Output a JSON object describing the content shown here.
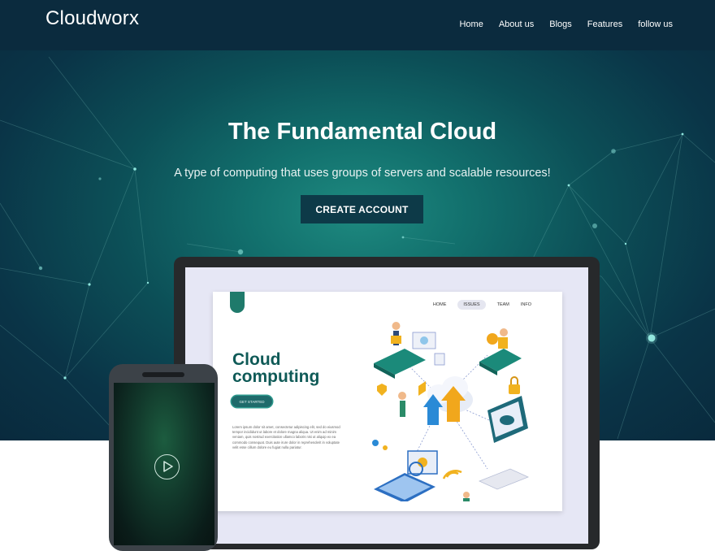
{
  "header": {
    "brand": "Cloudworx",
    "nav": [
      "Home",
      "About us",
      "Blogs",
      "Features",
      "follow us"
    ]
  },
  "hero": {
    "title": "The Fundamental Cloud",
    "subtitle": "A type of computing that uses groups of servers and scalable resources!",
    "cta_label": "CREATE ACCOUNT"
  },
  "mockup": {
    "nav": [
      "HOME",
      "ISSUES",
      "TEAM",
      "INFO"
    ],
    "active_nav": "ISSUES",
    "title_line1": "Cloud",
    "title_line2": "computing",
    "button_label": "GET STARTED",
    "body_text": "Lorem ipsum dolor sit amet, consectetur adipiscing elit, sed do eiusmod tempor incididunt ut labore et dolore magna aliqua. Ut enim ad minim veniam, quis nostrud exercitation ullamco laboris nisi ut aliquip ex ea commodo consequat. Duis aute irure dolor in reprehenderit in voluptate velit esse cillum dolore eu fugiat nulla pariatur."
  },
  "phone": {
    "icon": "play-icon"
  },
  "colors": {
    "header_bg": "#0b2b3e",
    "hero_center": "#1e8a80",
    "hero_edge": "#092a3d",
    "cta_bg": "#0d3a48",
    "mockup_accent": "#1f7a6b"
  }
}
